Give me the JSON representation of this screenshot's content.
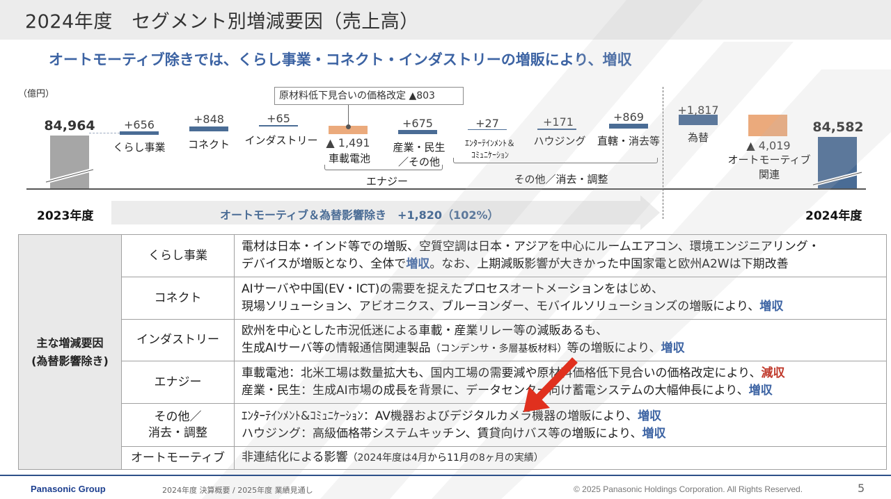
{
  "title": "2024年度　セグメント別増減要因（売上高）",
  "subtitle": "オートモーティブ除きでは、くらし事業・コネクト・インダストリーの増販により、増収",
  "unit": "（億円）",
  "colors": {
    "accent": "#3c63a3",
    "bar_blue": "#4a6c95",
    "bar_gray": "#a6a6a6",
    "bar_orange": "#ebaa7c",
    "decrease_red": "#c0392b"
  },
  "waterfall": {
    "start_value": "84,964",
    "end_value": "84,582",
    "start_year": "2023年度",
    "end_year": "2024年度",
    "note": "原材料低下見合いの価格改定 ▲803",
    "steps": [
      {
        "value": "+656",
        "label": "くらし事業"
      },
      {
        "value": "+848",
        "label": "コネクト"
      },
      {
        "value": "+65",
        "label": "インダストリー"
      },
      {
        "value": "▲ 1,491",
        "label": "車載電池"
      },
      {
        "value": "+675",
        "label": "産業・民生",
        "label2": "／その他"
      },
      {
        "value": "+27",
        "label": "ｴﾝﾀｰﾃｲﾝﾒﾝﾄ＆",
        "label2": "ｺﾐｭﾆｹｰｼｮﾝ"
      },
      {
        "value": "+171",
        "label": "ハウジング"
      },
      {
        "value": "+869",
        "label": "直轄・消去等"
      },
      {
        "value": "+1,817",
        "label": "為替"
      },
      {
        "value": "▲ 4,019",
        "label": "オートモーティブ",
        "label2": "関連"
      }
    ],
    "groups": {
      "energy": "エナジー",
      "other": "その他／消去・調整"
    },
    "arrow_text": "オートモーティブ＆為替影響除き　+1,820（102%）"
  },
  "table": {
    "main_label_1": "主な増減要因",
    "main_label_2": "(為替影響除き)",
    "rows": [
      {
        "segment": "くらし事業",
        "line1": "電材は日本・インド等での増販、空質空調は日本・アジアを中心にルームエアコン、環境エンジニアリング・",
        "line2a": "デバイスが増販となり、全体で",
        "line2b": "増収",
        "line2c": "。なお、上期減販影響が大きかった中国家電と欧州A2Wは下期改善"
      },
      {
        "segment": "コネクト",
        "line1": "AIサーバや中国(EV・ICT)の需要を捉えたプロセスオートメーションをはじめ、",
        "line2a": "現場ソリューション、アビオニクス、ブルーヨンダー、モバイルソリューションズの増販により、",
        "line2b": "増収"
      },
      {
        "segment": "インダストリー",
        "line1": "欧州を中心とした市況低迷による車載・産業リレー等の減販あるも、",
        "line2a": "生成AIサーバ等の情報通信関連製品",
        "line2s": "（コンデンサ・多層基板材料）",
        "line2c": "等の増販により、",
        "line2b": "増収"
      },
      {
        "segment": "エナジー",
        "line1a": "車載電池：北米工場は数量拡大も、国内工場の需要減や原材料価格低下見合いの価格改定により、",
        "line1b": "減収",
        "line2a": "産業・民生：生成AI市場の成長を背景に、データセンター向け蓄電システムの大幅伸長により、",
        "line2b": "増収"
      },
      {
        "segment": "その他／",
        "segment2": "消去・調整",
        "line1a": "ｴﾝﾀｰﾃｲﾝﾒﾝﾄ&ｺﾐｭﾆｹｰｼｮﾝ：AV機器およびデジタルカメラ機器の増販により、",
        "line1b": "増収",
        "line2a": "ハウジング：高級価格帯システムキッチン、賃貸向けバス等の増販により、",
        "line2b": "増収"
      },
      {
        "segment": "オートモーティブ",
        "line1a": "非連結化による影響",
        "line1s": "（2024年度は4月から11月の8ヶ月の実績）"
      }
    ]
  },
  "footer": {
    "logo": "Panasonic Group",
    "doc": "2024年度 決算概要 / 2025年度 業績見通し",
    "copyright": "© 2025 Panasonic Holdings Corporation. All Rights Reserved.",
    "page": "5"
  }
}
